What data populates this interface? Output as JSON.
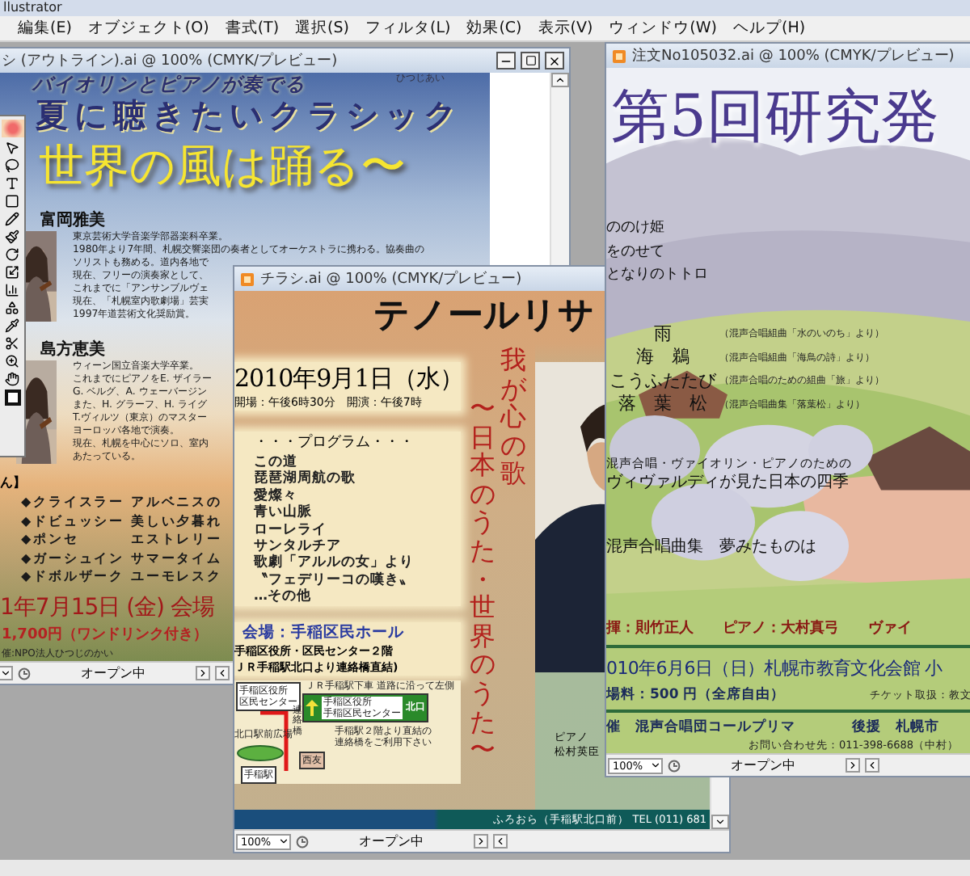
{
  "app": {
    "title": "llustrator"
  },
  "menu": [
    "編集(E)",
    "オブジェクト(O)",
    "書式(T)",
    "選択(S)",
    "フィルタ(L)",
    "効果(C)",
    "表示(V)",
    "ウィンドウ(W)",
    "ヘルプ(H)"
  ],
  "outline_window": {
    "title": "シ (アウトライン).ai @ 100% (CMYK/プレビュー)",
    "status": "オープン中",
    "flyer": {
      "corner": "ひつじあい",
      "subtitle": "バイオリンとピアノが奏でる",
      "title": "夏に聴きたいクラシック",
      "theme": "世界の風は踊る〜",
      "performers": [
        {
          "name": "富岡雅美",
          "bio": [
            "東京芸術大学音楽学部器楽科卒業。",
            "1980年より7年間、札幌交響楽団の奏者としてオーケストラに携わる。協奏曲の",
            "ソリストも務める。道内各地で",
            "現在、フリーの演奏家として、",
            "これまでに「アンサンブルヴェ",
            "現在、「札幌室内歌劇場」芸実",
            "1997年道芸術文化奨励賞。"
          ]
        },
        {
          "name": "島方恵美",
          "bio": [
            "ウィーン国立音楽大学卒業。",
            "これまでにピアノをE. ザイラー",
            "G. ベルグ、A. ウェーバージン",
            "また、H. グラーフ、H. ライグ",
            "T.ヴィルツ（東京）のマスター",
            "ヨーロッパ各地で演奏。",
            "現在、札幌を中心にソロ、室内",
            "あたっている。"
          ]
        }
      ],
      "program_head": "ん】",
      "program": [
        {
          "composer": "◆クライスラー",
          "piece": "アルベニスの"
        },
        {
          "composer": "◆ドビュッシー",
          "piece": "美しい夕暮れ"
        },
        {
          "composer": "◆ポンセ",
          "piece": "エストレリー"
        },
        {
          "composer": "◆ガーシュイン",
          "piece": "サマータイム"
        },
        {
          "composer": "◆ドボルザーク",
          "piece": "ユーモレスク"
        }
      ],
      "date": "1年7月15日 (金) 会場",
      "price": "1,700円（ワンドリンク付き）",
      "organizer": "催:NPO法人ひつじのかい"
    }
  },
  "flyer_window": {
    "title": "チラシ.ai @ 100% (CMYK/プレビュー)",
    "zoom": "100%",
    "status": "オープン中",
    "flyer": {
      "title": "テノールリサ",
      "date": "2010年9月1日（水）",
      "times": "開場：午後6時30分　開演：午後7時",
      "program_title": "・・・プログラム・・・",
      "program": [
        "この道",
        "琵琶湖周航の歌",
        "愛燦々",
        "青い山脈",
        "ローレライ",
        "サンタルチア",
        "歌劇「アルルの女」より",
        "〝フェデリーコの嘆き〟",
        "…その他"
      ],
      "venue": "会場：手稲区民ホール",
      "address": [
        "手稲区役所・区民センター２階",
        "ＪＲ手稲駅北口より連絡橋直結)"
      ],
      "map": {
        "office": [
          "手稲区役所",
          "区民センター"
        ],
        "direction": "ＪＲ手稲駅下車 道路に沿って左側",
        "sign": [
          "手稲区役所",
          "手稲区民センター"
        ],
        "exit": "北口",
        "note": [
          "手稲駅２階より直結の",
          "連絡橋をご利用下さい"
        ],
        "plaza": "北口駅前広場",
        "store": "西友",
        "bridge": "連絡橋",
        "station": "手稲駅"
      },
      "vertical": [
        "我が心の歌",
        "〜日本のうた・世界のうた〜"
      ],
      "pianist": [
        "ピアノ",
        "松村英臣"
      ],
      "contact": "ふろおら（手稲駅北口前） TEL (011) 681"
    }
  },
  "order_window": {
    "title": "注文No105032.ai @ 100% (CMYK/プレビュー)",
    "zoom": "100%",
    "status": "オープン中",
    "flyer": {
      "title": "第5回研究発",
      "songs": [
        "ののけ姫",
        "をのせて",
        "となりのトトロ"
      ],
      "pieces": [
        {
          "title": "雨",
          "source": "（混声合唱組曲「水のいのち」より）"
        },
        {
          "title": "海　鵜",
          "source": "（混声合唱組曲「海鳥の詩」より）"
        },
        {
          "title": "こうふたたび",
          "source": "（混声合唱のための組曲「旅」より）"
        },
        {
          "title": "落　葉　松",
          "source": "（混声合唱曲集「落葉松」より）"
        }
      ],
      "suite_note": "混声合唱・ヴァイオリン・ピアノのための",
      "suite": "ヴィヴァルディが見た日本の四季",
      "collection": "混声合唱曲集　夢みたものは",
      "credits": [
        "揮：則竹正人",
        "ピアノ：大村真弓",
        "ヴァイ"
      ],
      "date": "010年6月6日（日）札幌市教育文化会館 小",
      "fee": "場料：500 円（全席自由）",
      "tickets": "チケット取扱：教文",
      "host": "催　混声合唱団コールプリマ",
      "support": "後援　札幌市",
      "inquiry": "お問い合わせ先：011-398-6688（中村）"
    }
  }
}
